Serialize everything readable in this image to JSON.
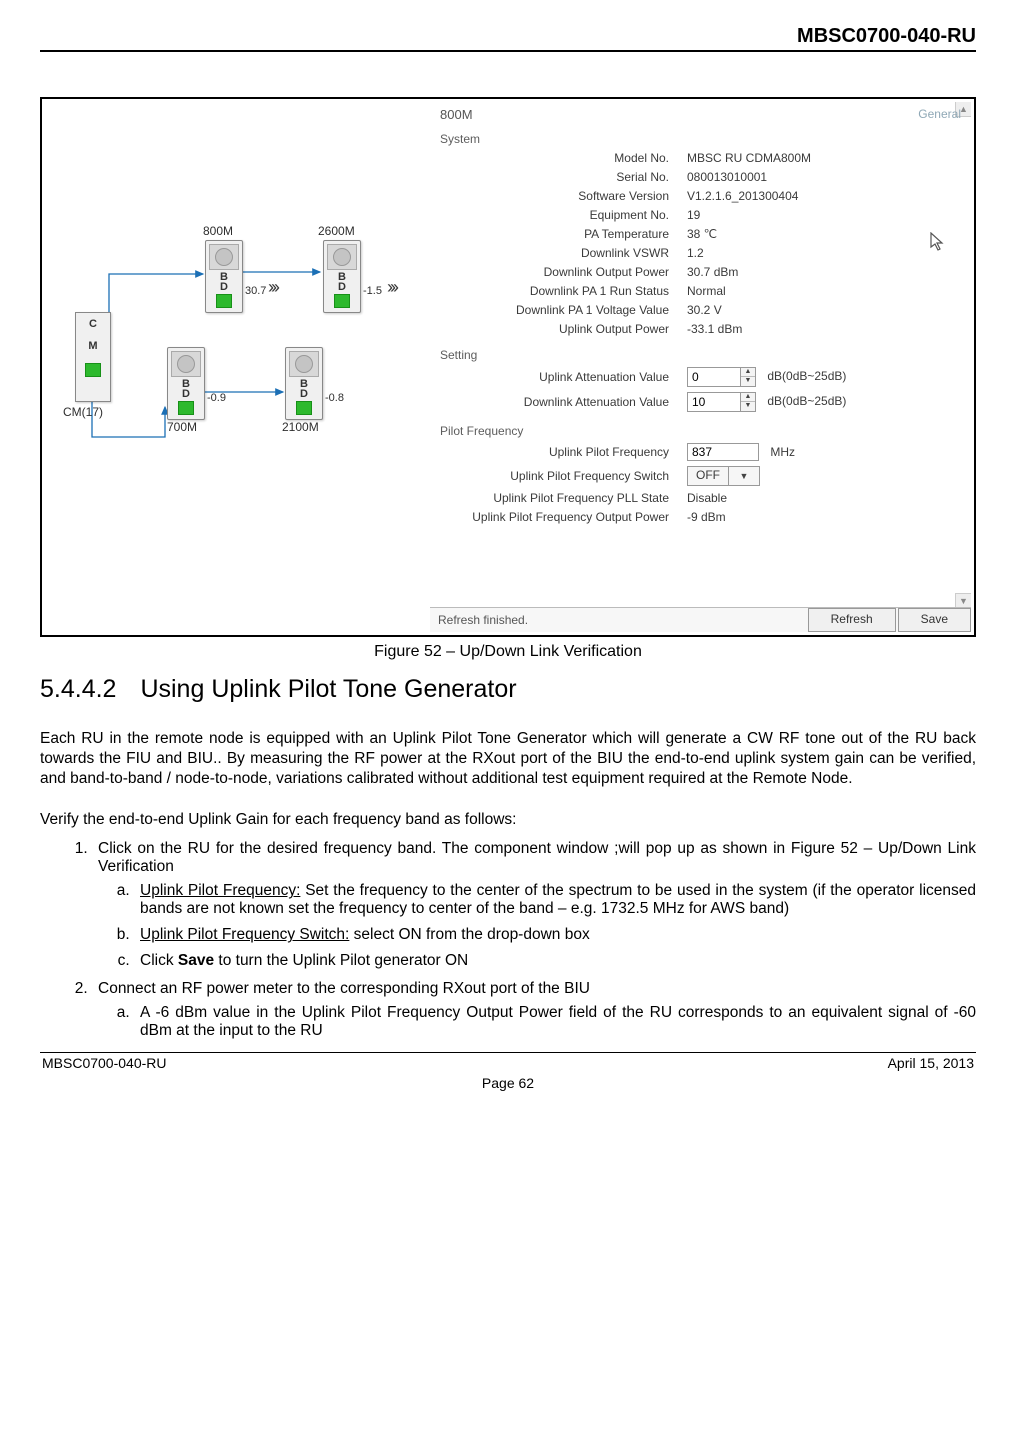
{
  "header": {
    "doc_id": "MBSC0700-040-RU"
  },
  "screenshot": {
    "tab_title": "800M",
    "general_link": "General",
    "diagram": {
      "cm": {
        "label_top": "C",
        "label_bot": "M",
        "caption": "CM(17)"
      },
      "modules": [
        {
          "name": "800M",
          "bd": "B\nD",
          "value": "30.7"
        },
        {
          "name": "2600M",
          "bd": "B\nD",
          "value": "-1.5"
        },
        {
          "name": "700M",
          "bd": "B\nD",
          "value": "-0.9"
        },
        {
          "name": "2100M",
          "bd": "B\nD",
          "value": "-0.8"
        }
      ]
    },
    "system_header": "System",
    "system": [
      {
        "k": "Model No.",
        "v": "MBSC RU CDMA800M"
      },
      {
        "k": "Serial No.",
        "v": "080013010001"
      },
      {
        "k": "Software Version",
        "v": "V1.2.1.6_201300404"
      },
      {
        "k": "Equipment No.",
        "v": "19"
      },
      {
        "k": "PA Temperature",
        "v": "38   ℃"
      },
      {
        "k": "Downlink VSWR",
        "v": "1.2"
      },
      {
        "k": "Downlink Output Power",
        "v": "30.7   dBm"
      },
      {
        "k": "Downlink PA 1 Run Status",
        "v": "Normal"
      },
      {
        "k": "Downlink PA 1 Voltage Value",
        "v": "30.2   V"
      },
      {
        "k": "Uplink Output Power",
        "v": "-33.1   dBm"
      }
    ],
    "setting_header": "Setting",
    "setting": [
      {
        "k": "Uplink Attenuation Value",
        "val": "0",
        "unit": "dB(0dB~25dB)"
      },
      {
        "k": "Downlink Attenuation Value",
        "val": "10",
        "unit": "dB(0dB~25dB)"
      }
    ],
    "pilot_header": "Pilot Frequency",
    "pilot": {
      "freq_k": "Uplink Pilot Frequency",
      "freq_v": "837",
      "freq_unit": "MHz",
      "switch_k": "Uplink Pilot Frequency Switch",
      "switch_v": "OFF",
      "pll_k": "Uplink Pilot Frequency PLL State",
      "pll_v": "Disable",
      "out_k": "Uplink Pilot Frequency Output Power",
      "out_v": "-9   dBm"
    },
    "footer_status": "Refresh finished.",
    "refresh_btn": "Refresh",
    "save_btn": "Save"
  },
  "figure_caption": "Figure 52 – Up/Down Link Verification",
  "section": {
    "number": "5.4.4.2",
    "title": "Using Uplink Pilot Tone Generator"
  },
  "para1": "Each RU in the remote node is equipped with an Uplink Pilot Tone Generator which will generate a CW RF tone out of the RU back towards the FIU and BIU.. By measuring the RF power at the RXout port of the BIU the end-to-end uplink system gain can be verified, and band-to-band / node-to-node, variations calibrated without additional test equipment required at the Remote Node.",
  "para2": "Verify the end-to-end Uplink Gain for each frequency band as follows:",
  "steps": {
    "s1": "Click on the RU for the desired frequency band. The component window ;will pop up as shown in Figure 52 – Up/Down Link Verification",
    "s1a_label": "Uplink Pilot Frequency:",
    "s1a_text": " Set the frequency to the center of the spectrum to be used in the system (if the operator licensed bands are not known set the frequency to center of the band – e.g. 1732.5 MHz for AWS band)",
    "s1b_label": "Uplink Pilot Frequency Switch:",
    "s1b_text": " select ON from the drop-down box",
    "s1c_pre": "Click ",
    "s1c_bold": "Save",
    "s1c_post": " to turn the Uplink Pilot generator ON",
    "s2": "Connect an RF power meter to the corresponding RXout port of the BIU",
    "s2a": "A -6 dBm value in the Uplink Pilot Frequency Output Power field of the RU corresponds to an equivalent signal of -60 dBm at the input to the RU"
  },
  "footer": {
    "left": "MBSC0700-040-RU",
    "right": "April 15, 2013",
    "page": "Page 62"
  }
}
